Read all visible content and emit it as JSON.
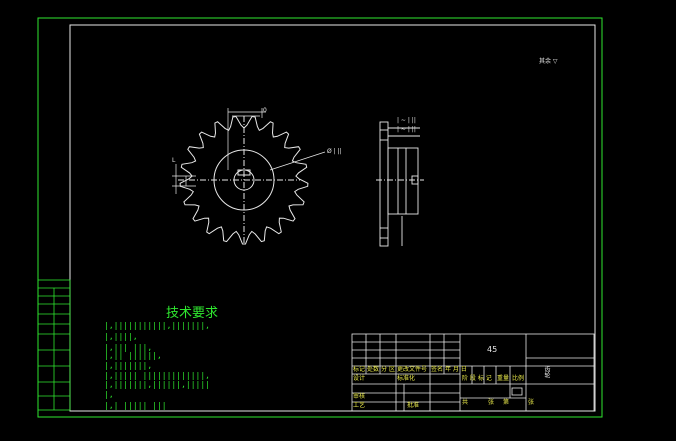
{
  "tech_requirements": {
    "title": "技术要求",
    "lines": [
      "|,|||||||||||,|||||||,",
      "|,||||,",
      "|,||| |||,",
      "|,|| ||||||,",
      "|,|||||||,",
      "|,||||| |||||||||||||,",
      "|,|||||||,||||||,|||||",
      "|,",
      "|,| ||||| |||"
    ]
  },
  "annotations": {
    "roughness": "其余 ▽",
    "dim_top": "0",
    "dim_left": "L",
    "dim_right": "Ø | ||",
    "side_dim_1": "| ~ | ||",
    "side_dim_2": "| ~ | ||"
  },
  "title_block": {
    "material": "45",
    "scale_header": "比例",
    "mark_header": "阶 段 标 记",
    "weight_header": "重量",
    "total_label": "共",
    "sheet_label": "张",
    "sheet_no_label": "第",
    "row_headers": [
      "标记",
      "处数",
      "分",
      "区",
      "更改文件号",
      "签名",
      "年 月 日"
    ],
    "design_label": "设计",
    "standardize_label": "标准化",
    "review_label": "审核",
    "process_label": "工艺",
    "approve_label": "批准",
    "right_label": "齿轮"
  }
}
